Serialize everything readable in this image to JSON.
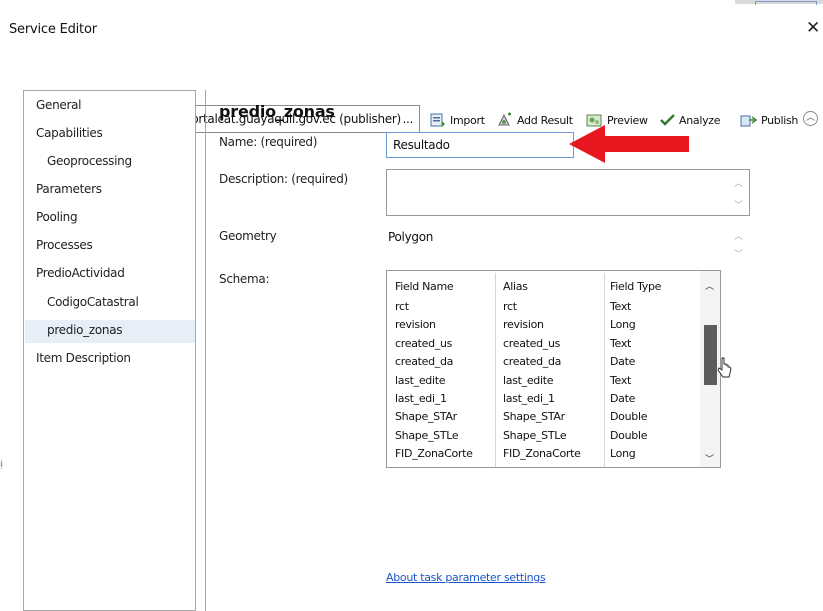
{
  "window": {
    "title": "Service Editor",
    "close_glyph": "✕"
  },
  "toolbar": {
    "connection": "Connection: arcgis on geoportalcat.guayaquil.gov.ec (publisher)",
    "connection_more": "...",
    "import_label": "Import",
    "add_result_label": "Add Result",
    "preview_label": "Preview",
    "analyze_label": "Analyze",
    "publish_label": "Publish"
  },
  "sidebar": {
    "items": [
      {
        "label": "General"
      },
      {
        "label": "Capabilities"
      },
      {
        "label": "Geoprocessing"
      },
      {
        "label": "Parameters"
      },
      {
        "label": "Pooling"
      },
      {
        "label": "Processes"
      },
      {
        "label": "PredioActividad"
      },
      {
        "label": "CodigoCatastral"
      },
      {
        "label": "predio_zonas",
        "selected": true
      },
      {
        "label": "Item Description"
      }
    ]
  },
  "main": {
    "heading": "predio_zonas",
    "name_label": "Name:  (required)",
    "name_value": "Resultado",
    "description_label": "Description:  (required)",
    "geometry_label": "Geometry",
    "geometry_value": "Polygon",
    "schema_label": "Schema:",
    "schema_columns": [
      "Field Name",
      "Alias",
      "Field Type"
    ],
    "schema_rows": [
      [
        "rct",
        "rct",
        "Text"
      ],
      [
        "revision",
        "revision",
        "Long"
      ],
      [
        "created_us",
        "created_us",
        "Text"
      ],
      [
        "created_da",
        "created_da",
        "Date"
      ],
      [
        "last_edite",
        "last_edite",
        "Text"
      ],
      [
        "last_edi_1",
        "last_edi_1",
        "Date"
      ],
      [
        "Shape_STAr",
        "Shape_STAr",
        "Double"
      ],
      [
        "Shape_STLe",
        "Shape_STLe",
        "Double"
      ],
      [
        "FID_ZonaCorte",
        "FID_ZonaCorte",
        "Long"
      ]
    ],
    "about_link": "About task parameter settings"
  },
  "colors": {
    "arrow": "#e8171f",
    "link": "#1a56c9",
    "selection": "#e6eef8",
    "focus_border": "#6b9bd4"
  }
}
